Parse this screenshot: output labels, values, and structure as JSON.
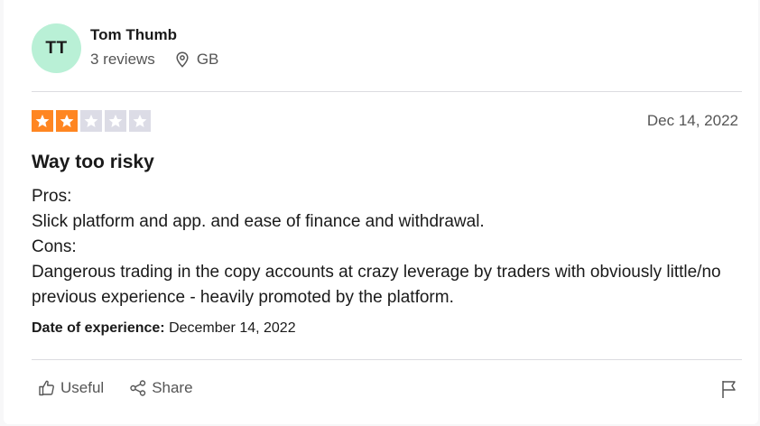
{
  "reviewer": {
    "initials": "TT",
    "name": "Tom Thumb",
    "reviews": "3 reviews",
    "country": "GB",
    "avatar_color": "#b9f0d6"
  },
  "review": {
    "rating": 2,
    "max_rating": 5,
    "date": "Dec 14, 2022",
    "title": "Way too risky",
    "lines": [
      "Pros:",
      "Slick platform and app. and ease of finance and withdrawal.",
      "Cons:",
      "Dangerous trading in the copy accounts at crazy leverage by traders with obviously little/no previous experience - heavily promoted by the platform."
    ],
    "experience_label": "Date of experience:",
    "experience_date": "December 14, 2022"
  },
  "actions": {
    "useful_label": "Useful",
    "share_label": "Share"
  },
  "colors": {
    "star_on": "#ff8622",
    "star_off": "#dcdce6"
  },
  "icons": [
    "location-pin-icon",
    "thumbs-up-icon",
    "share-icon",
    "flag-icon",
    "star-icon"
  ]
}
